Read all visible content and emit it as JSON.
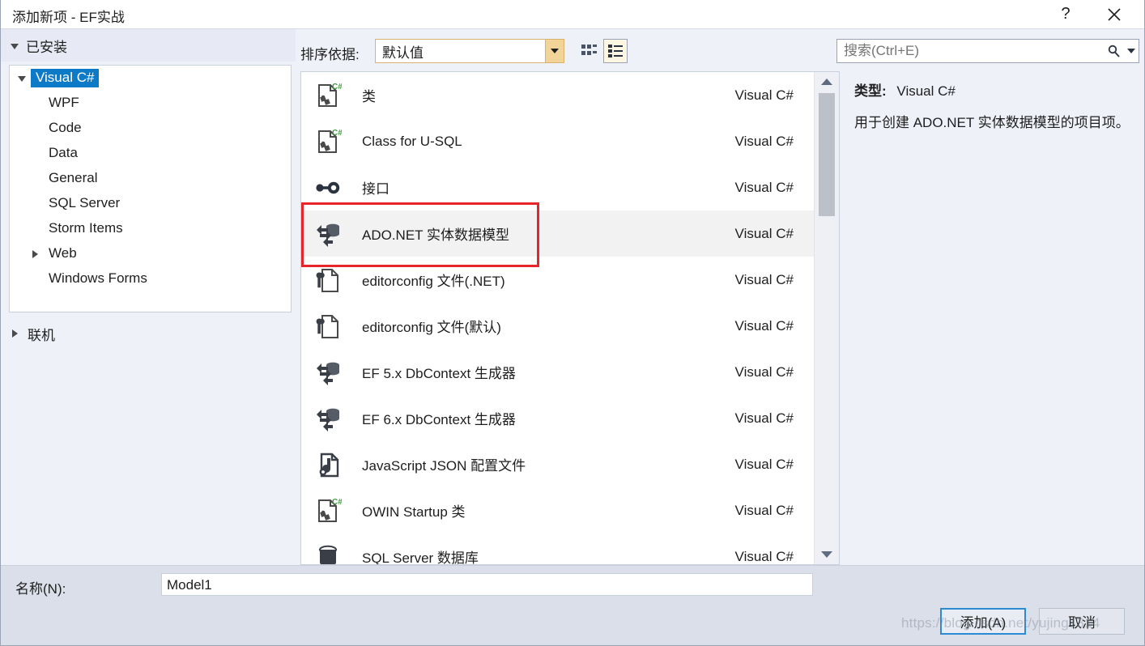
{
  "window": {
    "title": "添加新项 - EF实战",
    "help_icon": "question-mark-icon",
    "close_icon": "close-icon"
  },
  "sidebar": {
    "header": "已安装",
    "tree": {
      "root": "Visual C#",
      "children": [
        "WPF",
        "Code",
        "Data",
        "General",
        "SQL Server",
        "Storm Items",
        "Web",
        "Windows Forms"
      ]
    },
    "online": "联机"
  },
  "toolbar": {
    "sort_label": "排序依据:",
    "sort_value": "默认值",
    "grid_view_icon": "grid-view-icon",
    "list_view_icon": "list-view-icon"
  },
  "search": {
    "placeholder": "搜索(Ctrl+E)",
    "icon": "search-icon",
    "dropdown_icon": "chevron-down-icon"
  },
  "list": {
    "items": [
      {
        "name": "类",
        "kind": "Visual C#",
        "icon": "csharp-class-icon",
        "selected": false
      },
      {
        "name": "Class for U-SQL",
        "kind": "Visual C#",
        "icon": "csharp-class-icon",
        "selected": false
      },
      {
        "name": "接口",
        "kind": "Visual C#",
        "icon": "interface-icon",
        "selected": false
      },
      {
        "name": "ADO.NET 实体数据模型",
        "kind": "Visual C#",
        "icon": "entity-data-model-icon",
        "selected": true
      },
      {
        "name": "editorconfig 文件(.NET)",
        "kind": "Visual C#",
        "icon": "editorconfig-icon",
        "selected": false
      },
      {
        "name": "editorconfig 文件(默认)",
        "kind": "Visual C#",
        "icon": "editorconfig-icon",
        "selected": false
      },
      {
        "name": "EF 5.x DbContext 生成器",
        "kind": "Visual C#",
        "icon": "entity-data-model-icon",
        "selected": false
      },
      {
        "name": "EF 6.x DbContext 生成器",
        "kind": "Visual C#",
        "icon": "entity-data-model-icon",
        "selected": false
      },
      {
        "name": "JavaScript JSON 配置文件",
        "kind": "Visual C#",
        "icon": "json-file-icon",
        "selected": false
      },
      {
        "name": "OWIN Startup 类",
        "kind": "Visual C#",
        "icon": "csharp-class-icon",
        "selected": false
      },
      {
        "name": "SQL Server 数据库",
        "kind": "Visual C#",
        "icon": "database-icon",
        "selected": false
      }
    ]
  },
  "details": {
    "type_label": "类型:",
    "type_value": "Visual C#",
    "description": "用于创建 ADO.NET 实体数据模型的项目项。"
  },
  "footer": {
    "name_label": "名称(N):",
    "name_value": "Model1",
    "add_button": "添加(A)",
    "cancel_button": "取消"
  },
  "watermark": "https://blog.csdn.net/yujing1314",
  "colors": {
    "accent": "#0d7ac8",
    "annotation": "#e8262a",
    "dialog_bg": "#eff1f8",
    "footer_bg": "#dbdfe9"
  }
}
